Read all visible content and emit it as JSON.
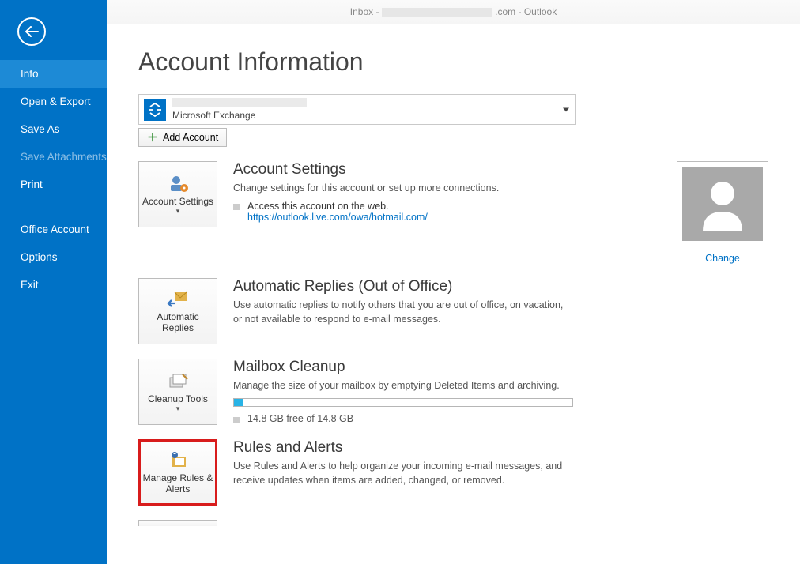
{
  "titlebar": {
    "prefix": "Inbox - ",
    "suffix": ".com - Outlook"
  },
  "sidebar": {
    "items": [
      {
        "label": "Info",
        "selected": true
      },
      {
        "label": "Open & Export"
      },
      {
        "label": "Save As"
      },
      {
        "label": "Save Attachments",
        "disabled": true
      },
      {
        "label": "Print"
      },
      {
        "label": "Office Account",
        "gapBefore": true
      },
      {
        "label": "Options"
      },
      {
        "label": "Exit"
      }
    ]
  },
  "page": {
    "title": "Account Information"
  },
  "account": {
    "type": "Microsoft Exchange",
    "add_label": "Add Account"
  },
  "sections": {
    "settings": {
      "tile": "Account Settings",
      "title": "Account Settings",
      "desc": "Change settings for this account or set up more connections.",
      "sub_text": "Access this account on the web.",
      "sub_link": "https://outlook.live.com/owa/hotmail.com/",
      "change": "Change"
    },
    "auto": {
      "tile": "Automatic Replies",
      "title": "Automatic Replies (Out of Office)",
      "desc": "Use automatic replies to notify others that you are out of office, on vacation, or not available to respond to e-mail messages."
    },
    "cleanup": {
      "tile": "Cleanup Tools",
      "title": "Mailbox Cleanup",
      "desc": "Manage the size of your mailbox by emptying Deleted Items and archiving.",
      "storage": "14.8 GB free of 14.8 GB"
    },
    "rules": {
      "tile": "Manage Rules & Alerts",
      "title": "Rules and Alerts",
      "desc": "Use Rules and Alerts to help organize your incoming e-mail messages, and receive updates when items are added, changed, or removed."
    }
  }
}
